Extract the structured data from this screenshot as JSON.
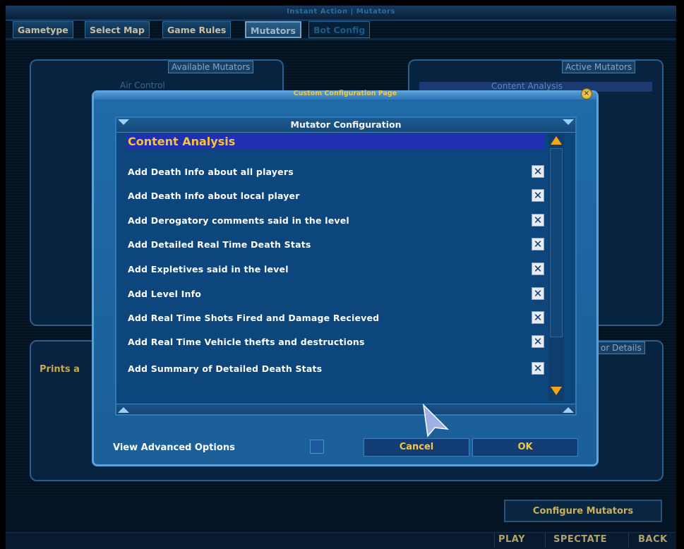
{
  "window_title": "Instant Action | Mutators",
  "tabs": [
    {
      "label": "Gametype"
    },
    {
      "label": "Select Map"
    },
    {
      "label": "Game Rules"
    },
    {
      "label": "Mutators"
    },
    {
      "label": "Bot Config"
    }
  ],
  "background": {
    "available_caption": "Available Mutators",
    "available_first": "Air Control",
    "active_caption": "Active Mutators",
    "active_first": "Content Analysis",
    "details_caption": "or Details",
    "description_text": "Prints a",
    "configure_button": "Configure Mutators"
  },
  "footer": {
    "play": "PLAY",
    "spectate": "SPECTATE",
    "back": "BACK"
  },
  "dialog": {
    "title": "Custom Configuration Page",
    "panel_header": "Mutator Configuration",
    "section": "Content Analysis",
    "options": [
      {
        "label": "Add Death Info about all players",
        "checked": true
      },
      {
        "label": "Add Death Info about local player",
        "checked": true
      },
      {
        "label": "Add Derogatory comments said in the level",
        "checked": true
      },
      {
        "label": "Add Detailed Real Time Death Stats",
        "checked": true
      },
      {
        "label": "Add Expletives said in the level",
        "checked": true
      },
      {
        "label": "Add Level Info",
        "checked": true
      },
      {
        "label": "Add Real Time Shots Fired and Damage Recieved",
        "checked": true
      },
      {
        "label": "Add Real Time Vehicle thefts and destructions",
        "checked": true
      },
      {
        "label": "Add Summary of Detailed Death Stats",
        "checked": true
      }
    ],
    "advanced_label": "View Advanced Options",
    "advanced_checked": false,
    "cancel": "Cancel",
    "ok": "OK",
    "check_mark": "✕"
  },
  "colors": {
    "accent_gold": "#f2c74a",
    "section_bg": "#2130b0",
    "dialog_blue": "#1f6aa8"
  }
}
